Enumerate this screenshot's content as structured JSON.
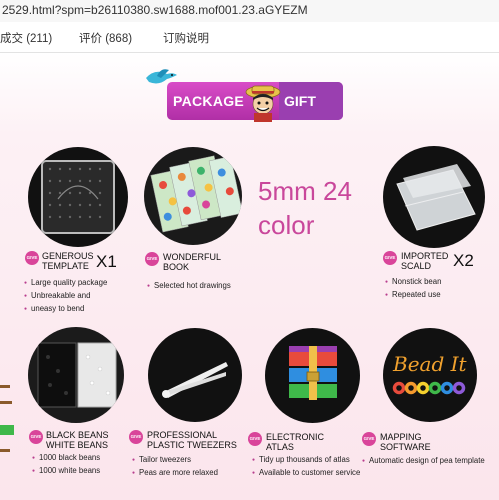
{
  "browser": {
    "url": "2529.html?spm=b26110380.sw1688.mof001.23.aGYEZM"
  },
  "tabs": [
    {
      "label": "成交 (211)"
    },
    {
      "label": "评价 (868)"
    },
    {
      "label": "订购说明"
    }
  ],
  "banner": {
    "left": "PACKAGE",
    "right": "GIFT"
  },
  "headline": {
    "line1": "5mm 24",
    "line2": "color"
  },
  "give_badge": "GIVE",
  "colors": {
    "accent": "#c9479b",
    "banner": "#b02fa6",
    "background": "#fbe5ec"
  },
  "items": [
    {
      "title1": "GENEROUS",
      "title2": "TEMPLATE",
      "multiplier": "X1",
      "bullets": [
        "Large quality package",
        "Unbreakable and",
        "uneasy to bend"
      ]
    },
    {
      "title1": "WONDERFUL",
      "title2": "BOOK",
      "multiplier": "",
      "bullets": [
        "Selected hot drawings"
      ]
    },
    {
      "title1": "IMPORTED",
      "title2": "SCALD",
      "multiplier": "X2",
      "bullets": [
        "Nonstick bean",
        "Repeated use"
      ]
    },
    {
      "title1": "BLACK BEANS",
      "title2": "WHITE BEANS",
      "multiplier": "",
      "bullets": [
        "1000 black beans",
        "1000 white beans"
      ]
    },
    {
      "title1": "PROFESSIONAL",
      "title2": "PLASTIC TWEEZERS",
      "multiplier": "",
      "bullets": [
        "Tailor tweezers",
        "Peas are more relaxed"
      ]
    },
    {
      "title1": "ELECTRONIC",
      "title2": "ATLAS",
      "multiplier": "",
      "bullets": [
        "Tidy up thousands of atlas",
        "Available to customer service"
      ]
    },
    {
      "title1": "MAPPING",
      "title2": "SOFTWARE",
      "multiplier": "",
      "bullets": [
        "Automatic design of pea template"
      ]
    }
  ],
  "software_logo": {
    "text": "Bead It"
  }
}
